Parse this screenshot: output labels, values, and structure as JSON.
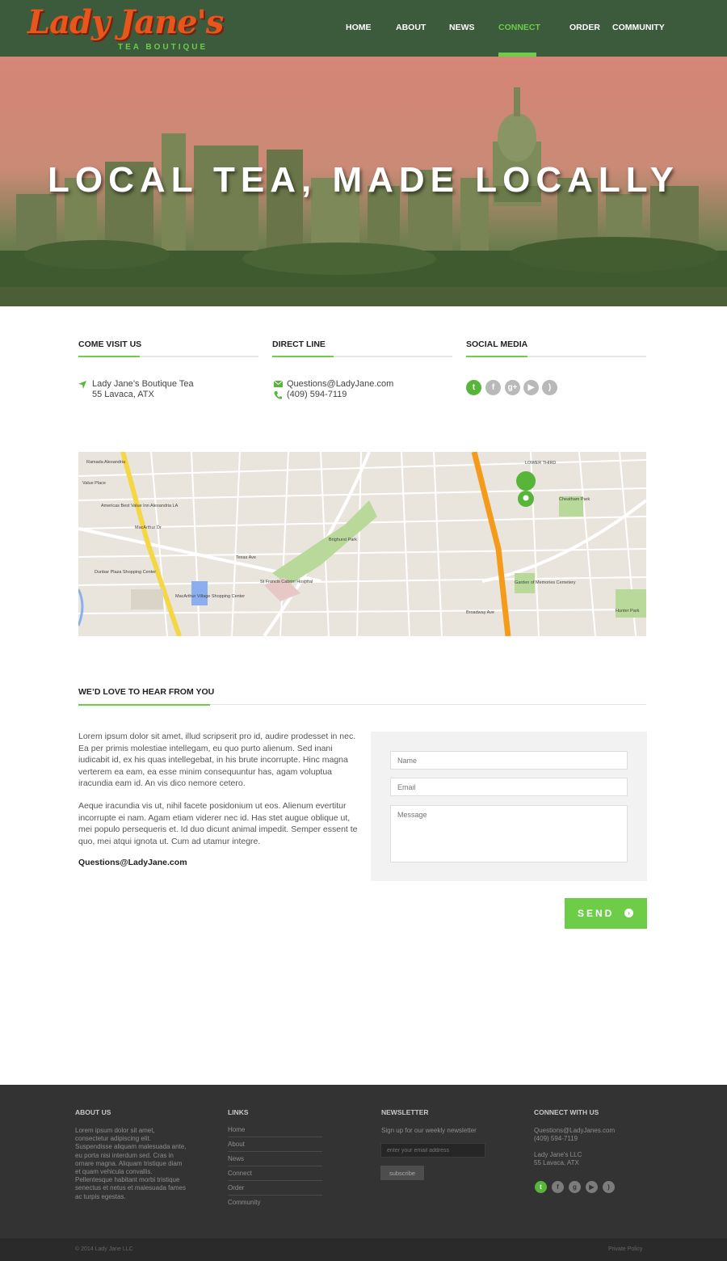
{
  "brand": {
    "logo_script": "Lady Jane's",
    "logo_sub": "TEA BOUTIQUE",
    "accent_color": "#6dcc48",
    "header_color": "#3c5a3c"
  },
  "nav": {
    "home": "HOME",
    "about": "ABOUT",
    "news": "NEWS",
    "connect": "CONNECT",
    "order": "ORDER",
    "community": "COMMUNITY",
    "active": "CONNECT"
  },
  "hero": {
    "title": "LOCAL TEA, MADE LOCALLY"
  },
  "visit": {
    "heading": "COME VISIT US",
    "line1": "Lady Jane’s Boutique Tea",
    "line2": "55 Lavaca, ATX",
    "icon": "location-arrow-icon"
  },
  "direct": {
    "heading": "DIRECT LINE",
    "email": "Questions@LadyJane.com",
    "phone": "(409) 594-7119",
    "email_icon": "envelope-icon",
    "phone_icon": "phone-icon"
  },
  "social": {
    "heading": "SOCIAL MEDIA",
    "icons": [
      "twitter-icon",
      "facebook-icon",
      "google-plus-icon",
      "youtube-icon",
      "rss-icon"
    ]
  },
  "map": {
    "labels": {
      "dunbar": "Dunbar Plaza Shopping Center",
      "macarthur": "MacArthur Village Shopping Center",
      "brinkmeyer": "Brighurst Park",
      "stfrancis": "St Francis Cabrini Hospital",
      "cheatham": "Cheatham Park",
      "garden": "Garden of Memories Cemetery",
      "hunter": "Hunter Park",
      "lower_third": "LOWER THIRD",
      "texas_ave": "Texas Ave",
      "broadway": "Broadway Ave",
      "macarthur_dr": "MacArthur Dr",
      "value_place": "Value Place",
      "americas": "Americas Best Value Inn Alexandria LA",
      "ramada": "Ramada Alexandria"
    }
  },
  "contact": {
    "heading": "WE’D LOVE TO HEAR FROM YOU",
    "para1": "Lorem ipsum dolor sit amet, illud scripserit pro id, audire prodesset in nec. Ea per primis molestiae intellegam, eu quo purto alienum. Sed inani iudicabit id, ex his quas intellegebat, in his brute incorrupte. Hinc magna verterem ea eam, ea esse minim consequuntur has, agam voluptua iracundia eam id. An vis dico nemore cetero.",
    "para2": "Aeque iracundia vis ut, nihil facete posidonium ut eos. Alienum evertitur incorrupte ei nam. Agam etiam viderer nec id. Has stet augue oblique ut, mei populo persequeris et. Id duo dicunt animal impedit. Semper essent te quo, mei atqui ignota ut. Cum ad utamur integre.",
    "email": "Questions@LadyJane.com",
    "form": {
      "name_placeholder": "Name",
      "email_placeholder": "Email",
      "message_placeholder": "Message",
      "send_label": "SEND"
    }
  },
  "footer": {
    "about": {
      "heading": "ABOUT US",
      "text": "Lorem ipsum dolor sit amet, consectetur adipiscing elit. Suspendisse aliquam malesuada ante, eu porta nisi interdum sed. Cras in ornare magna. Aliquam tristique diam et quam vehicula convallis. Pellentesque habitant morbi tristique senectus et netus et malesuada fames ac turpis egestas."
    },
    "links": {
      "heading": "LINKS",
      "items": [
        "Home",
        "About",
        "News",
        "Connect",
        "Order",
        "Community"
      ]
    },
    "newsletter": {
      "heading": "NEWSLETTER",
      "text": "Sign up for our weekly newsletter",
      "placeholder": "enter your email address",
      "button": "subscribe"
    },
    "connect": {
      "heading": "CONNECT WITH US",
      "email": "Questions@LadyJanes.com",
      "phone": "(409) 594-7119",
      "company": "Lady Jane's LLC",
      "address": "55 Lavaca, ATX"
    },
    "copyright": "© 2014  Lady Jane LLC",
    "privacy": "Private Policy"
  }
}
